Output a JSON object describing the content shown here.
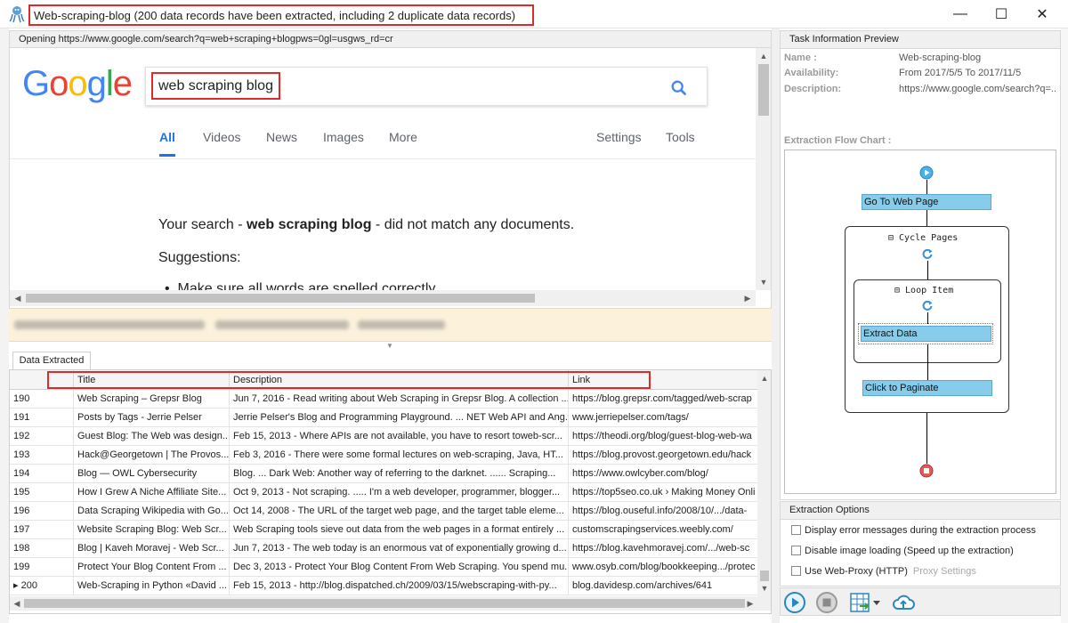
{
  "window": {
    "title": "Web-scraping-blog (200 data records have been extracted, including 2 duplicate data records)",
    "minimize_glyph": "—",
    "maximize_glyph": "☐",
    "close_glyph": "✕"
  },
  "address": {
    "text": "Opening https://www.google.com/search?q=web+scraping+blogpws=0gl=usgws_rd=cr"
  },
  "google": {
    "logo_letters": [
      "G",
      "o",
      "o",
      "g",
      "l",
      "e"
    ],
    "logo_colors": [
      "#4285f4",
      "#ea4335",
      "#fbbc05",
      "#4285f4",
      "#34a853",
      "#ea4335"
    ],
    "query": "web scraping blog",
    "tabs": [
      "All",
      "Videos",
      "News",
      "Images",
      "More"
    ],
    "tools": [
      "Settings",
      "Tools"
    ],
    "msg_prefix": "Your search - ",
    "msg_query": "web scraping blog",
    "msg_suffix": " - did not match any documents.",
    "suggestions_label": "Suggestions:",
    "suggestion_1": "Make sure all words are spelled correctly."
  },
  "data_tab": {
    "label": "Data Extracted"
  },
  "grid": {
    "columns": [
      "",
      "Title",
      "Description",
      "Link"
    ],
    "rows": [
      {
        "num": "190",
        "title": "Web Scraping – Grepsr Blog",
        "desc": "Jun 7, 2016 - Read writing about Web Scraping in Grepsr Blog. A collection ...",
        "link": "https://blog.grepsr.com/tagged/web-scrap"
      },
      {
        "num": "191",
        "title": "Posts by Tags - Jerrie Pelser",
        "desc": "Jerrie Pelser's Blog and Programming Playground. ... NET Web API and Ang...",
        "link": "www.jerriepelser.com/tags/"
      },
      {
        "num": "192",
        "title": "Guest Blog: The Web was design...",
        "desc": "Feb 15, 2013 - Where APIs are not available, you have to resort toweb-scr...",
        "link": "https://theodi.org/blog/guest-blog-web-wa"
      },
      {
        "num": "193",
        "title": "Hack@Georgetown | The Provos...",
        "desc": "Feb 3, 2016 - There were some formal lectures on web-scraping, Java, HT...",
        "link": "https://blog.provost.georgetown.edu/hack"
      },
      {
        "num": "194",
        "title": "Blog — OWL Cybersecurity",
        "desc": "Blog. ... Dark Web: Another way of referring to the darknet. ...... Scraping...",
        "link": "https://www.owlcyber.com/blog/"
      },
      {
        "num": "195",
        "title": "How I Grew A Niche Affiliate Site...",
        "desc": "Oct 9, 2013 - Not scraping. ..... I'm a web developer, programmer, blogger...",
        "link": "https://top5seo.co.uk › Making Money Onli"
      },
      {
        "num": "196",
        "title": "Data Scraping Wikipedia with Go...",
        "desc": "Oct 14, 2008 - The URL of the target web page, and the target table eleme...",
        "link": "https://blog.ouseful.info/2008/10/.../data-"
      },
      {
        "num": "197",
        "title": "Website Scraping Blog: Web Scr...",
        "desc": "Web Scraping tools sieve out data from the web pages in a format entirely ...",
        "link": "customscrapingservices.weebly.com/"
      },
      {
        "num": "198",
        "title": "Blog | Kaveh Moravej - Web Scr...",
        "desc": "Jun 7, 2013 - The web today is an enormous vat of exponentially growing d...",
        "link": "https://blog.kavehmoravej.com/.../web-sc"
      },
      {
        "num": "199",
        "title": "Protect Your Blog Content From ...",
        "desc": "Dec 3, 2013 - Protect Your Blog Content From Web Scraping. You spend mu...",
        "link": "www.osyb.com/blog/bookkeeping.../protec"
      },
      {
        "num": "▸ 200",
        "title": "Web-Scraping in Python «David ...",
        "desc": "Feb 15, 2013 - http://blog.dispatched.ch/2009/03/15/webscraping-with-py...",
        "link": "blog.davidesp.com/archives/641"
      }
    ]
  },
  "task_info": {
    "header": "Task Information Preview",
    "name_label": "Name :",
    "name_value": "Web-scraping-blog",
    "availability_label": "Availability:",
    "availability_value": "From 2017/5/5 To 2017/11/5",
    "description_label": "Description:",
    "description_value": "https://www.google.com/search?q=...",
    "flow_caption": "Extraction Flow Chart :"
  },
  "flow": {
    "go_to_web_page": "Go To Web Page",
    "cycle_pages": "⊟ Cycle Pages",
    "loop_item": "⊟ Loop Item",
    "extract_data": "Extract Data",
    "click_to_paginate": "Click to Paginate"
  },
  "options": {
    "header": "Extraction Options",
    "opt_errors": "Display error messages during the extraction process",
    "opt_images": "Disable image loading (Speed up the extraction)",
    "opt_proxy": "Use Web-Proxy (HTTP)",
    "proxy_settings": "Proxy Settings"
  },
  "toolbar": {
    "icons": [
      "play-icon",
      "stop-icon",
      "export-data-icon",
      "dropdown-arrow-icon",
      "cloud-upload-icon"
    ]
  },
  "colors": {
    "highlight": "#e0292b",
    "flow_node": "#87cdeb",
    "google_blue": "#1a73e8",
    "status_strip": "#fcf2dc"
  }
}
